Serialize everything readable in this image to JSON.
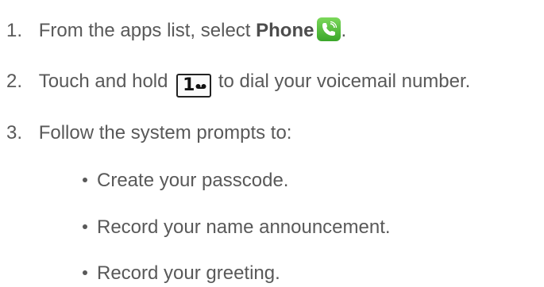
{
  "steps": [
    {
      "number": "1.",
      "text_before": "From the apps list, select ",
      "bold": "Phone",
      "text_after": "."
    },
    {
      "number": "2.",
      "text_before": "Touch and hold ",
      "key_label": "1",
      "text_after": " to dial your voicemail number."
    },
    {
      "number": "3.",
      "text": "Follow the system prompts to:"
    }
  ],
  "bullets": [
    "Create your passcode.",
    "Record your name announcement.",
    "Record your greeting."
  ],
  "icons": {
    "phone": "phone-app-icon",
    "key": "voicemail-key-1-icon"
  },
  "colors": {
    "text": "#595959",
    "phone_icon": "#4cbb37"
  }
}
